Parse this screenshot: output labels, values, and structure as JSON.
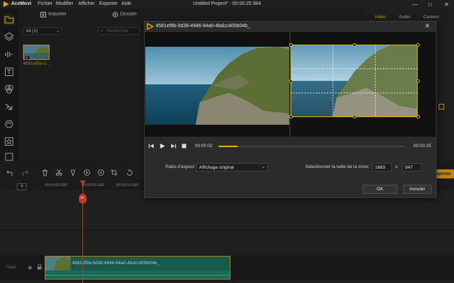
{
  "app": {
    "name": "AceMovi",
    "window_title": "Untitled Project* - 00:00:25.984",
    "menu": [
      "Fichier",
      "Modifier",
      "Afficher",
      "Exporter",
      "Aide"
    ],
    "window_controls": [
      "—",
      "□",
      "✕"
    ]
  },
  "media_panel": {
    "import_label": "Importer",
    "folder_label": "Dossier",
    "filter_value": "All (1)",
    "search_placeholder": "Rechercher",
    "thumbnail_name": "4581ef5b-0..."
  },
  "right_panel": {
    "tabs": [
      "Vidéo",
      "Audio",
      "Couleur"
    ]
  },
  "toolbar": {
    "export_label": "Exporter"
  },
  "timeline": {
    "ticks": [
      "00:00:00.000",
      "00:00:05.000",
      "00:00:10.000"
    ],
    "track_label": "Track",
    "clip_name": "4581ef5b-0d38-4946-94a0-4bdcc400b04b_"
  },
  "dialog": {
    "title": "4581ef5b-0d38-4946-94a0-4bdcc400b04b_",
    "current_time": "00:00:02",
    "total_time": "00:00:25",
    "progress": 0.1,
    "aspect_label": "Ratio d'aspect:",
    "aspect_value": "Affichage original",
    "zone_label": "Sélectionner la taille de la zone:",
    "width_value": "1683",
    "x_sep": "x",
    "height_value": "947",
    "ok_label": "OK",
    "cancel_label": "Annuler"
  },
  "colors": {
    "accent": "#e6b400",
    "clip_bg": "#1e6f5f",
    "playhead": "#c0392b",
    "dialog_bg": "#2b2b2b"
  }
}
